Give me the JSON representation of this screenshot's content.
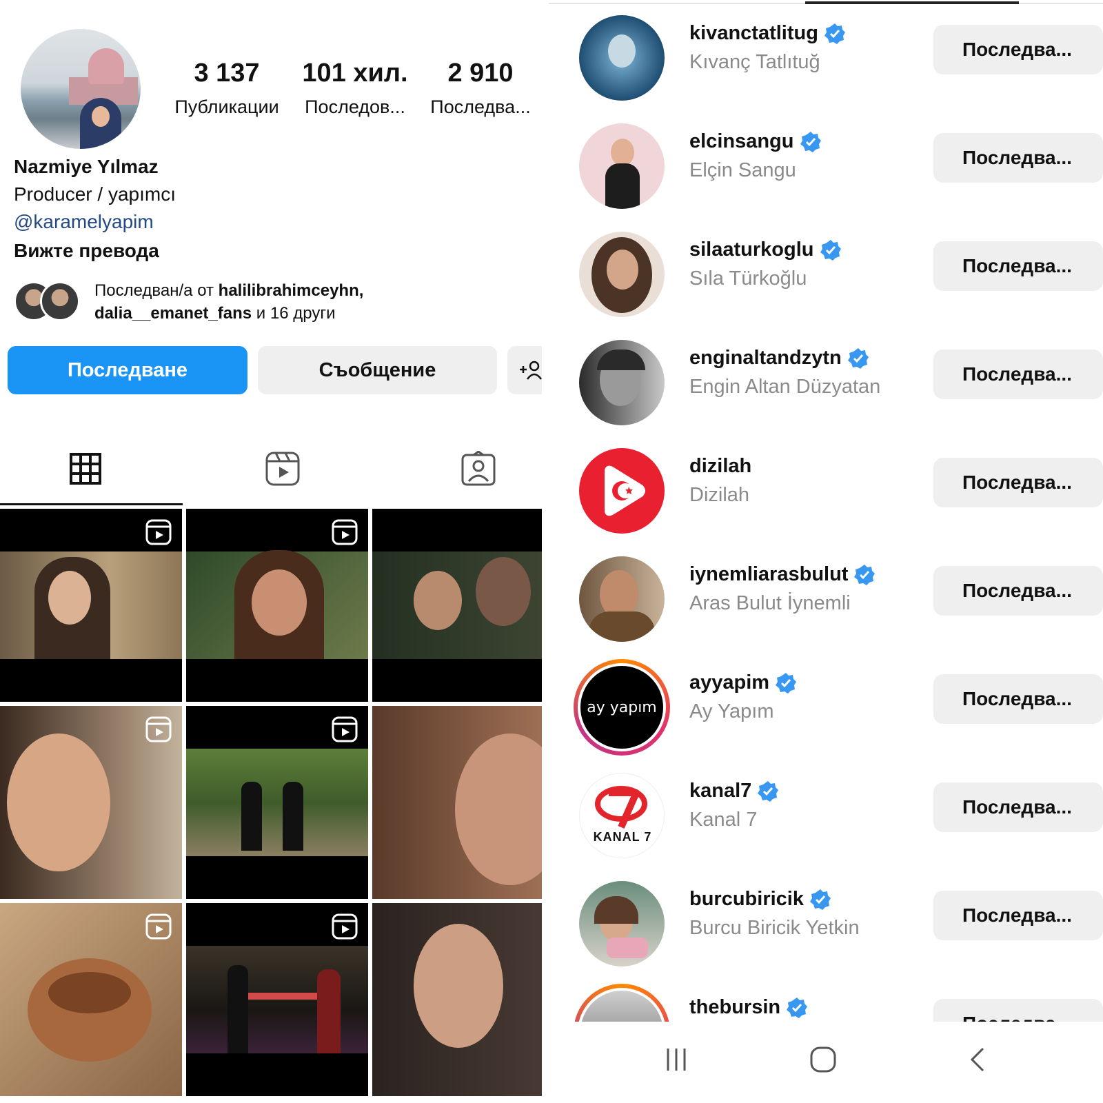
{
  "profile": {
    "stats": [
      {
        "value": "3 137",
        "label": "Публикации"
      },
      {
        "value": "101 хил.",
        "label": "Последов..."
      },
      {
        "value": "2 910",
        "label": "Последва..."
      }
    ],
    "name": "Nazmiye Yılmaz",
    "bio": "Producer / yapımcı",
    "link": "@karamelyapim",
    "translate": "Вижте превода",
    "followed_by": {
      "prefix": "Последван/а от ",
      "user1": "halilibrahimceyhn,",
      "user2": "dalia__emanet_fans",
      "suffix": " и 16 други"
    },
    "buttons": {
      "follow": "Последване",
      "message": "Съобщение",
      "add_user": "+👤"
    }
  },
  "following": [
    {
      "username": "kivanctatlitug",
      "full_name": "Kıvanç Tatlıtuğ",
      "verified": true,
      "button": "Последва..."
    },
    {
      "username": "elcinsangu",
      "full_name": "Elçin Sangu",
      "verified": true,
      "button": "Последва..."
    },
    {
      "username": "silaaturkoglu",
      "full_name": "Sıla Türkoğlu",
      "verified": true,
      "button": "Последва..."
    },
    {
      "username": "enginaltandzytn",
      "full_name": "Engin Altan Düzyatan",
      "verified": true,
      "button": "Последва..."
    },
    {
      "username": "dizilah",
      "full_name": "Dizilah",
      "verified": false,
      "button": "Последва..."
    },
    {
      "username": "iynemliarasbulut",
      "full_name": "Aras Bulut İynemli",
      "verified": true,
      "button": "Последва..."
    },
    {
      "username": "ayyapim",
      "full_name": "Ay Yapım",
      "verified": true,
      "button": "Последва..."
    },
    {
      "username": "kanal7",
      "full_name": "Kanal 7",
      "verified": true,
      "button": "Последва..."
    },
    {
      "username": "burcubiricik",
      "full_name": "Burcu Biricik Yetkin",
      "verified": true,
      "button": "Последва..."
    },
    {
      "username": "thebursin",
      "full_name": "",
      "verified": true,
      "button": "Последва..."
    }
  ],
  "logos": {
    "ayyapim": "ay yapım",
    "kanal7": "KANAL 7"
  },
  "colors": {
    "accent": "#1a95f5",
    "verified": "#3897f0",
    "secondary_text": "#8a8a8a",
    "button_bg": "#efefef"
  }
}
